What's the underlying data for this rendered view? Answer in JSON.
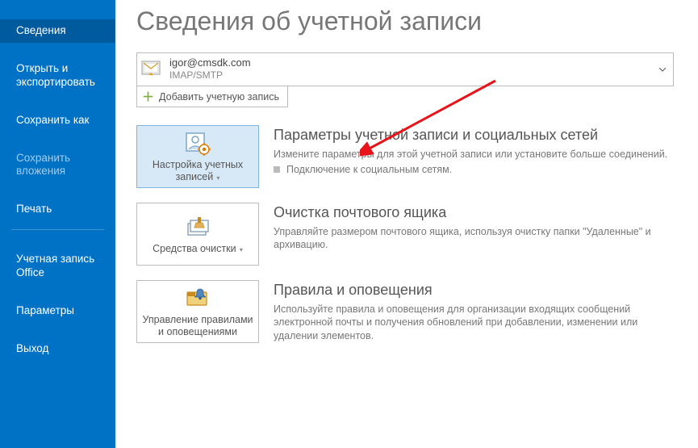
{
  "sidebar": [
    {
      "label": "Сведения",
      "state": "selected"
    },
    {
      "label": "Открыть и экспортировать",
      "state": ""
    },
    {
      "label": "Сохранить как",
      "state": ""
    },
    {
      "label": "Сохранить вложения",
      "state": "disabled"
    },
    {
      "label": "Печать",
      "state": ""
    },
    {
      "label": "Учетная запись Office",
      "state": ""
    },
    {
      "label": "Параметры",
      "state": ""
    },
    {
      "label": "Выход",
      "state": ""
    }
  ],
  "page_title": "Сведения об учетной записи",
  "account": {
    "email": "igor@cmsdk.com",
    "protocol": "IMAP/SMTP"
  },
  "add_account_label": "Добавить учетную запись",
  "sections": [
    {
      "card_label": "Настройка учетных записей",
      "has_dropdown": true,
      "selected": true,
      "title": "Параметры учетной записи и социальных сетей",
      "text": "Измените параметры для этой учетной записи или установите больше соединений.",
      "bullet": "Подключение к социальным сетям."
    },
    {
      "card_label": "Средства очистки",
      "has_dropdown": true,
      "selected": false,
      "title": "Очистка почтового ящика",
      "text": "Управляйте размером почтового ящика, используя очистку папки \"Удаленные\" и архивацию."
    },
    {
      "card_label": "Управление правилами и оповещениями",
      "has_dropdown": false,
      "selected": false,
      "title": "Правила и оповещения",
      "text": "Используйте правила и оповещения для организации входящих сообщений электронной почты и получения обновлений при добавлении, изменении или удалении элементов."
    }
  ]
}
